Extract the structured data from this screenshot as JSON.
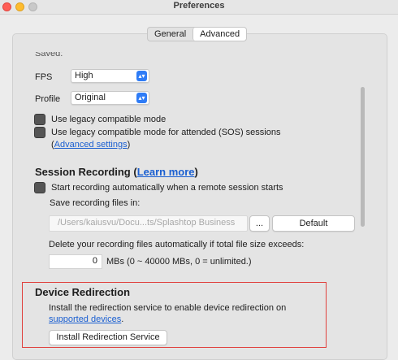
{
  "window": {
    "title": "Preferences"
  },
  "tabs": [
    {
      "label": "General"
    },
    {
      "label": "Advanced"
    }
  ],
  "truncated_label": "Saved:",
  "fps": {
    "label": "FPS",
    "value": "High"
  },
  "profile": {
    "label": "Profile",
    "value": "Original"
  },
  "legacy": {
    "mode_label": "Use legacy compatible mode",
    "sos_label": "Use legacy compatible mode for attended (SOS) sessions",
    "paren_open": "(",
    "advanced_link": "Advanced settings",
    "paren_close": ")"
  },
  "session_recording": {
    "title": "Session Recording",
    "paren_open": "(",
    "learn_more": "Learn more",
    "paren_close": ")",
    "auto_start_label": "Start recording automatically when a remote session starts",
    "save_files_label": "Save recording files in:",
    "path_value": "/Users/kaiusvu/Docu...ts/Splashtop Business",
    "browse_label": "...",
    "default_label": "Default",
    "delete_label": "Delete your recording files automatically if total file size exceeds:",
    "size_value": "0",
    "size_hint": "MBs (0 ~ 40000 MBs, 0 = unlimited.)"
  },
  "device_redirection": {
    "title": "Device Redirection",
    "description": "Install the redirection service to enable device redirection on",
    "supported_link": "supported devices",
    "period": ".",
    "install_button": "Install Redirection Service"
  },
  "colors": {
    "accent": "#2f7cf6",
    "link": "#1a5fd1",
    "highlight_border": "#e0403d"
  }
}
